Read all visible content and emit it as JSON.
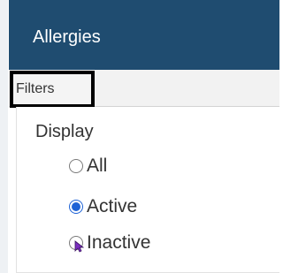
{
  "header": {
    "title": "Allergies"
  },
  "tabs": {
    "filters_label": "Filters"
  },
  "display": {
    "label": "Display",
    "options": [
      {
        "label": "All",
        "selected": false
      },
      {
        "label": "Active",
        "selected": true
      },
      {
        "label": "Inactive",
        "selected": false
      }
    ]
  },
  "colors": {
    "header_bg": "#1f4c70",
    "radio_selected": "#1f63d6",
    "cursor": "#7b2fbf"
  },
  "icons": {
    "cursor": "mouse-pointer-icon"
  }
}
